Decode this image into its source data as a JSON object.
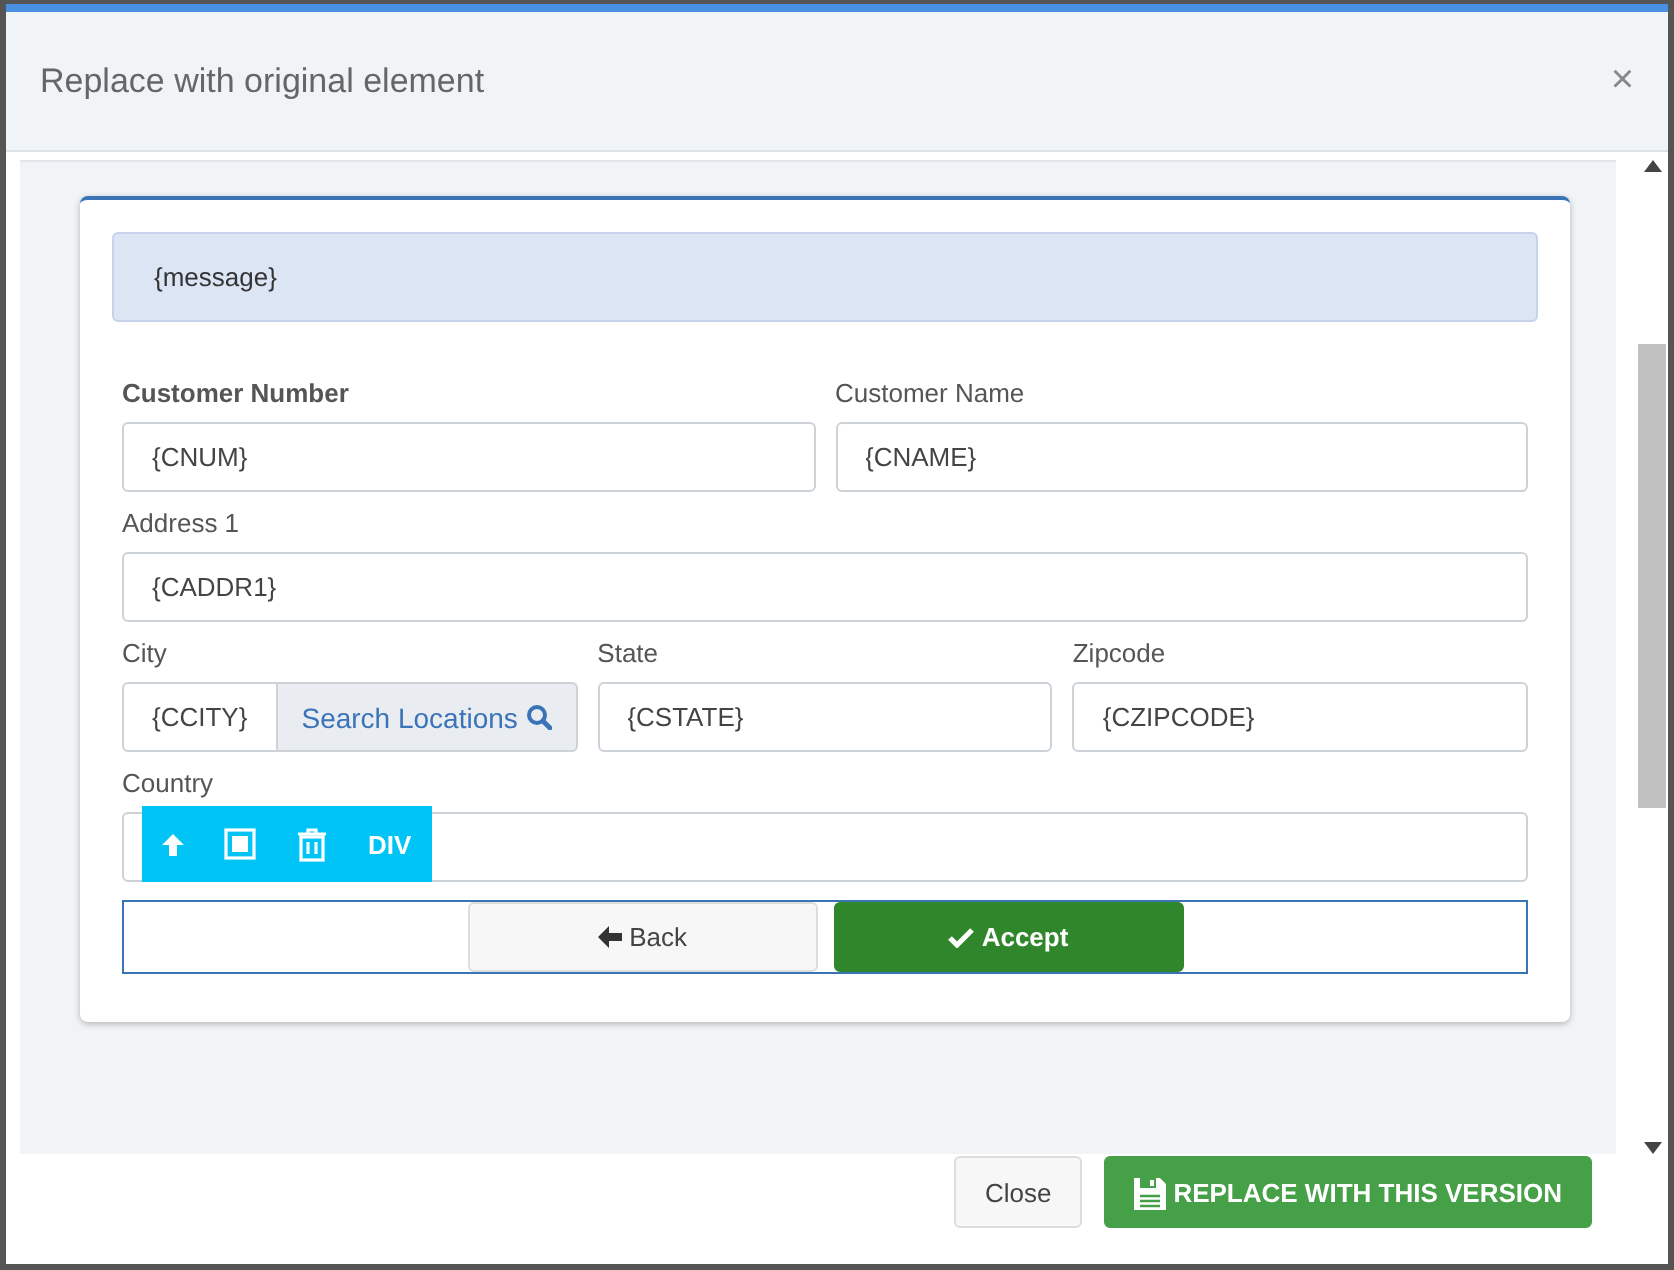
{
  "dialog": {
    "title": "Replace with original element",
    "close_symbol": "×"
  },
  "form": {
    "message": "{message}",
    "rows": [
      {
        "fields": [
          {
            "kind": "text",
            "label": "Customer Number",
            "bold": true,
            "value": "{CNUM}"
          },
          {
            "kind": "text",
            "label": "Customer Name",
            "bold": false,
            "value": "{CNAME}"
          }
        ]
      },
      {
        "fields": [
          {
            "kind": "text",
            "label": "Address 1",
            "bold": false,
            "value": "{CADDR1}"
          }
        ]
      },
      {
        "fields": [
          {
            "kind": "search",
            "label": "City",
            "bold": false,
            "value": "{CCITY}",
            "button": "Search Locations"
          },
          {
            "kind": "text",
            "label": "State",
            "bold": false,
            "value": "{CSTATE}"
          },
          {
            "kind": "text",
            "label": "Zipcode",
            "bold": false,
            "value": "{CZIPCODE}"
          }
        ]
      },
      {
        "fields": [
          {
            "kind": "text",
            "label": "Country",
            "bold": false
          }
        ]
      }
    ],
    "element_toolbar": {
      "tag": "DIV"
    },
    "buttons": [
      {
        "kind": "back",
        "label": "Back"
      },
      {
        "kind": "accept",
        "label": "Accept"
      }
    ]
  },
  "footer": {
    "buttons": [
      {
        "kind": "close",
        "label": "Close"
      },
      {
        "kind": "save",
        "label": "REPLACE WITH THIS VERSION"
      }
    ]
  }
}
